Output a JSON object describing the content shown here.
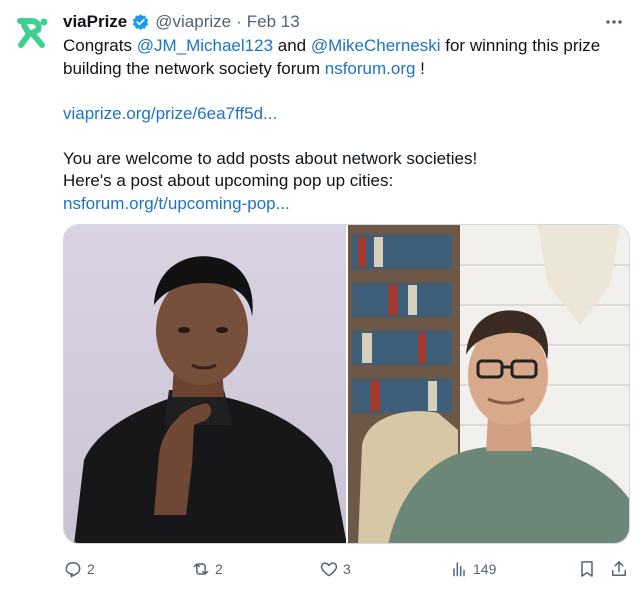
{
  "account": {
    "display_name": "viaPrize",
    "handle": "@viaprize",
    "separator": "·",
    "date": "Feb 13",
    "verified": true,
    "avatar_icon": "viaprize-logo",
    "avatar_color": "#3ed08e"
  },
  "tweet": {
    "line1_prefix": "Congrats ",
    "mention1": "@JM_Michael123",
    "line1_and": " and ",
    "mention2": "@MikeCherneski",
    "line1_suffix": " for winning this prize",
    "line2_prefix": "building the network society forum ",
    "link_forum": "nsforum.org",
    "line2_suffix": " !",
    "prize_link": "viaprize.org/prize/6ea7ff5d...",
    "line3": "You are welcome to add posts about network societies!",
    "line4": "Here's a post about upcoming pop up cities:",
    "post_link": "nsforum.org/t/upcoming-pop..."
  },
  "media": {
    "images": [
      "photo-young-man-black-turtleneck",
      "photo-man-glasses-bookshelf"
    ]
  },
  "actions": {
    "replies": "2",
    "reposts": "2",
    "likes": "3",
    "views": "149"
  },
  "colors": {
    "link": "#1d74c5",
    "muted": "#536471",
    "verified_badge": "#1d9bf0"
  }
}
